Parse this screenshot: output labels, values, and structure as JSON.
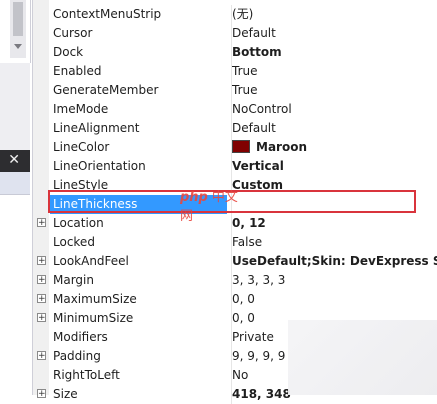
{
  "left_panel": {
    "close_glyph": "✕"
  },
  "properties": [
    {
      "name": "ContextMenuStrip",
      "value": "(无)",
      "bold": false,
      "expandable": false
    },
    {
      "name": "Cursor",
      "value": "Default",
      "bold": false,
      "expandable": false
    },
    {
      "name": "Dock",
      "value": "Bottom",
      "bold": true,
      "expandable": false
    },
    {
      "name": "Enabled",
      "value": "True",
      "bold": false,
      "expandable": false
    },
    {
      "name": "GenerateMember",
      "value": "True",
      "bold": false,
      "expandable": false
    },
    {
      "name": "ImeMode",
      "value": "NoControl",
      "bold": false,
      "expandable": false
    },
    {
      "name": "LineAlignment",
      "value": "Default",
      "bold": false,
      "expandable": false
    },
    {
      "name": "LineColor",
      "value": "Maroon",
      "bold": true,
      "expandable": false,
      "color": "#800000"
    },
    {
      "name": "LineOrientation",
      "value": "Vertical",
      "bold": true,
      "expandable": false
    },
    {
      "name": "LineStyle",
      "value": "Custom",
      "bold": true,
      "expandable": false
    },
    {
      "name": "LineThickness",
      "value": "",
      "bold": false,
      "expandable": false,
      "selected": true
    },
    {
      "name": "Location",
      "value": "0, 12",
      "bold": true,
      "expandable": true
    },
    {
      "name": "Locked",
      "value": "False",
      "bold": false,
      "expandable": false
    },
    {
      "name": "LookAndFeel",
      "value": "UseDefault;Skin: DevExpress S",
      "bold": true,
      "expandable": true
    },
    {
      "name": "Margin",
      "value": "3, 3, 3, 3",
      "bold": false,
      "expandable": true
    },
    {
      "name": "MaximumSize",
      "value": "0, 0",
      "bold": false,
      "expandable": true
    },
    {
      "name": "MinimumSize",
      "value": "0, 0",
      "bold": false,
      "expandable": true
    },
    {
      "name": "Modifiers",
      "value": "Private",
      "bold": false,
      "expandable": false
    },
    {
      "name": "Padding",
      "value": "9, 9, 9, 9",
      "bold": false,
      "expandable": true
    },
    {
      "name": "RightToLeft",
      "value": "No",
      "bold": false,
      "expandable": false
    },
    {
      "name": "Size",
      "value": "418, 348",
      "bold": true,
      "expandable": true
    }
  ],
  "watermark": {
    "logo": "php",
    "text": "中文网"
  },
  "colors": {
    "selection": "#3399ff",
    "highlight_border": "#d9343c",
    "line_color": "#800000"
  }
}
